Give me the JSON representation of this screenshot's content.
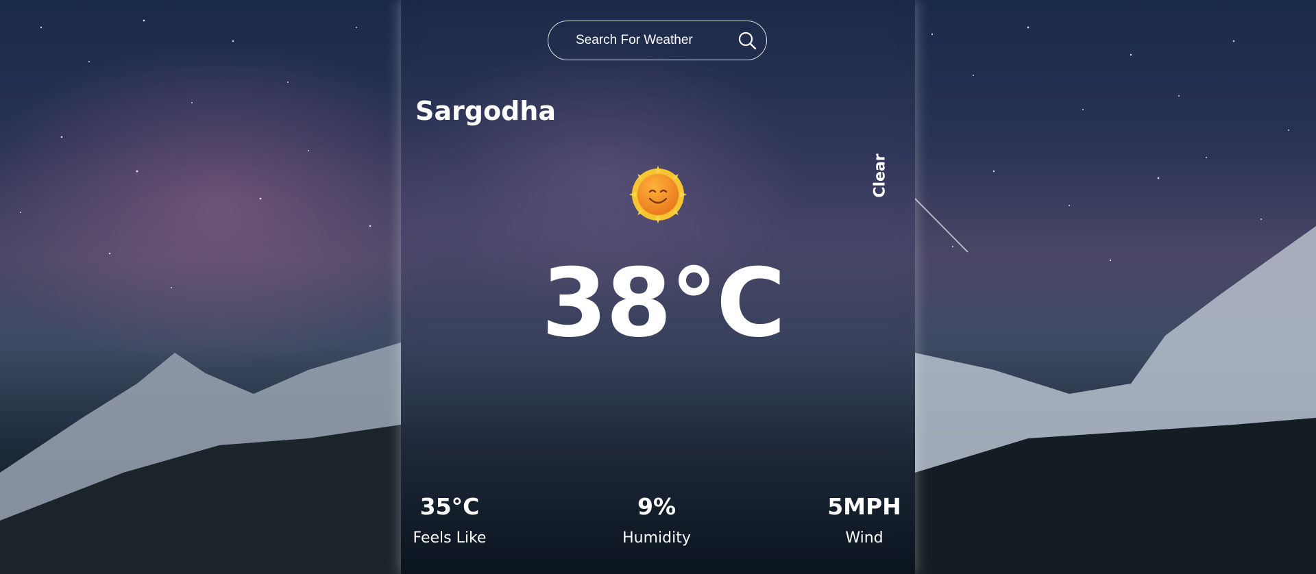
{
  "search": {
    "placeholder": "Search For Weather",
    "icon": "search-icon"
  },
  "weather": {
    "city": "Sargodha",
    "condition": "Clear",
    "icon": "sun-smiling-icon",
    "temperature": "38°C"
  },
  "stats": [
    {
      "value": "35°C",
      "label": "Feels Like"
    },
    {
      "value": "9%",
      "label": "Humidity"
    },
    {
      "value": "5MPH",
      "label": "Wind"
    }
  ],
  "colors": {
    "text": "#ffffff",
    "sun_outer": "#f7c532",
    "sun_inner": "#ef8a1b"
  }
}
